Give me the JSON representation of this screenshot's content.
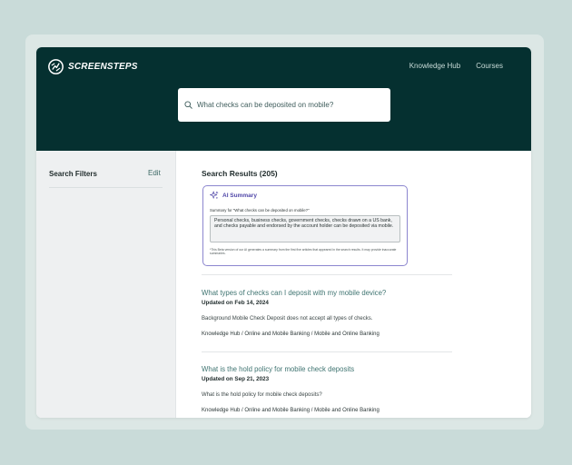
{
  "header": {
    "logo_text": "SCREENSTEPS",
    "nav": [
      "Knowledge Hub",
      "Courses"
    ],
    "search": {
      "value": "What checks can be deposited on mobile?",
      "placeholder": "Search"
    }
  },
  "sidebar": {
    "title": "Search Filters",
    "edit_label": "Edit"
  },
  "main": {
    "results_heading": "Search Results (205)",
    "ai_summary": {
      "title": "AI Summary",
      "summary_for": "Summary for \"What checks can be deposited on mobile?\"",
      "text": "Personal checks, business checks, government checks, checks drawn on a US bank, and checks payable and endorsed by the account holder can be deposited via mobile.",
      "disclaimer": "*This Beta version of our AI generates a summary from the first five articles that appeared in the search results. It may provide inaccurate summaries."
    },
    "results": [
      {
        "title": "What types of checks can I deposit with my mobile device?",
        "updated": "Updated on Feb 14, 2024",
        "snippet": "Background Mobile Check Deposit does not accept all types of checks.",
        "path": "Knowledge Hub / Online and Mobile Banking / Mobile and Online Banking"
      },
      {
        "title": "What is the hold policy for mobile check deposits",
        "updated": "Updated on Sep 21, 2023",
        "snippet": "What is the hold policy for mobile check deposits?",
        "path": "Knowledge Hub / Online and Mobile Banking / Mobile and Online Banking"
      }
    ]
  },
  "colors": {
    "header_bg": "#053030",
    "page_bg": "#c9dbd9",
    "link": "#3f7471",
    "ai_accent": "#4f46a8"
  }
}
